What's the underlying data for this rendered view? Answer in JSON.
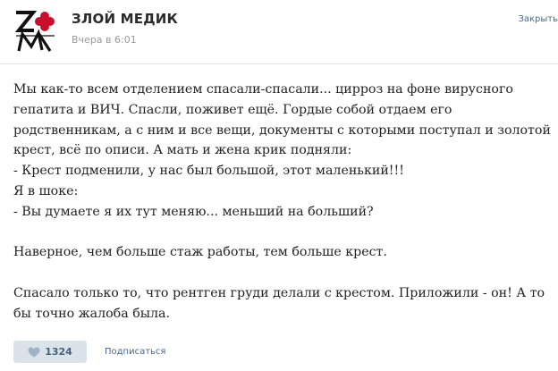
{
  "post": {
    "author": "ЗЛОЙ МЕДИК",
    "time": "Вчера в 6:01",
    "close_label": "Закрыть",
    "paragraphs": [
      "Мы как-то всем отделением спасали-спасали... цирроз на фоне вирусного",
      "гепатита и ВИЧ. Спасли, поживет ещё. Гордые собой отдаем его",
      "родственникам, а с ним и все вещи, документы с которыми поступал и золотой",
      "крест, всё по описи. А мать и жена крик подняли:",
      "- Крест подменили, у нас был большой, этот маленький!!!",
      "Я в шоке:",
      "- Вы думаете я их тут меняю... меньший на больший?",
      "",
      "Наверное, чем больше стаж работы, тем больше крест.",
      "",
      "Спасало только то, что рентген груди делали с крестом. Приложили - он! А то",
      "бы точно жалоба была."
    ]
  },
  "actions": {
    "like_count": "1324",
    "subscribe_label": "Подписаться"
  },
  "icons": {
    "avatar": "zm-logo-with-red-cross",
    "like": "heart-icon"
  },
  "colors": {
    "link": "#45688e",
    "like_bg": "#dae2ea",
    "logo_red": "#c8102e"
  }
}
